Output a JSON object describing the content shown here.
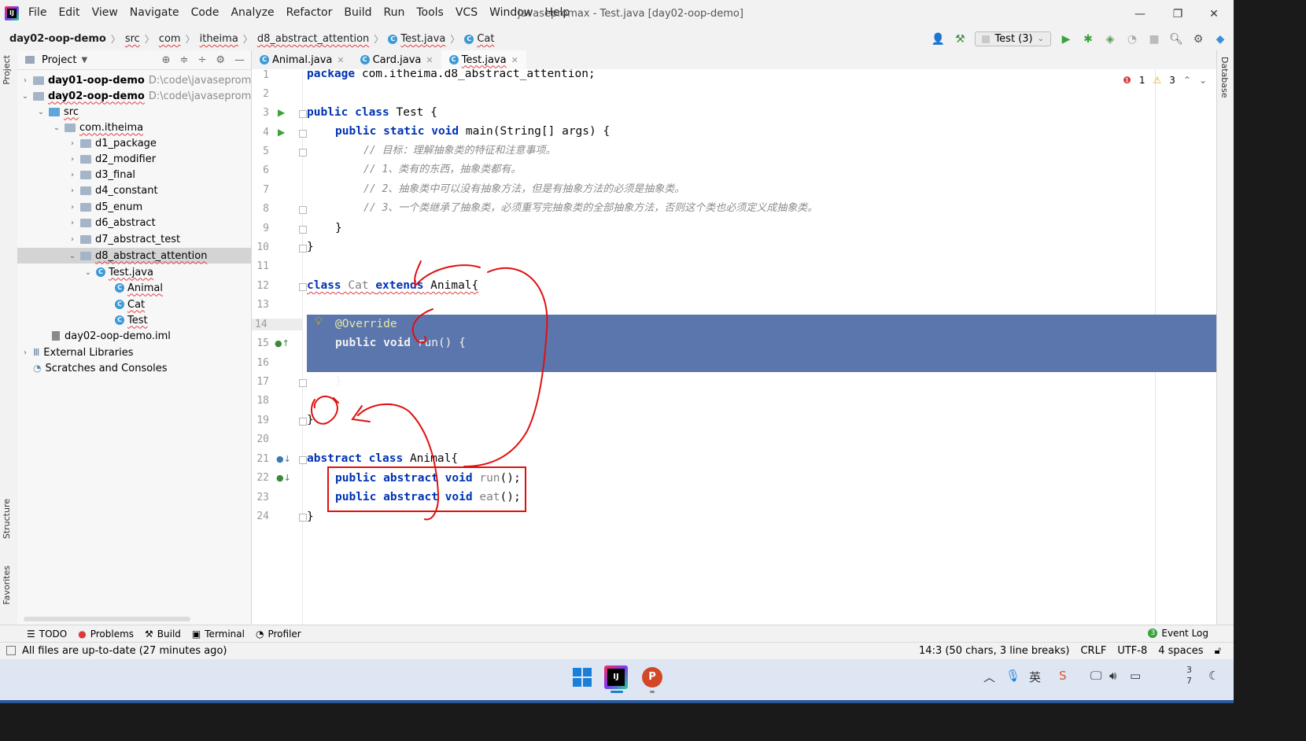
{
  "titlebar": {
    "menu": [
      "File",
      "Edit",
      "View",
      "Navigate",
      "Code",
      "Analyze",
      "Refactor",
      "Build",
      "Run",
      "Tools",
      "VCS",
      "Window",
      "Help"
    ],
    "window_title": "javasepromax - Test.java [day02-oop-demo]",
    "minimize": "—",
    "restore": "❐",
    "close": "✕"
  },
  "navbar": {
    "crumbs": [
      "day02-oop-demo",
      "src",
      "com",
      "itheima",
      "d8_abstract_attention",
      "Test.java",
      "Cat"
    ],
    "run_config": "Test (3)"
  },
  "left_tools": {
    "project_tab": "Project",
    "structure_tab": "Structure",
    "favorites_tab": "Favorites"
  },
  "right_tools": {
    "database_tab": "Database"
  },
  "project": {
    "title": "Project",
    "tree": [
      {
        "label": "day01-oop-demo",
        "path": "D:\\code\\javasepromax\\"
      },
      {
        "label": "day02-oop-demo",
        "path": "D:\\code\\javasepromax\\"
      },
      {
        "label": "src"
      },
      {
        "label": "com.itheima"
      },
      {
        "label": "d1_package"
      },
      {
        "label": "d2_modifier"
      },
      {
        "label": "d3_final"
      },
      {
        "label": "d4_constant"
      },
      {
        "label": "d5_enum"
      },
      {
        "label": "d6_abstract"
      },
      {
        "label": "d7_abstract_test"
      },
      {
        "label": "d8_abstract_attention"
      },
      {
        "label": "Test.java"
      },
      {
        "label": "Animal"
      },
      {
        "label": "Cat"
      },
      {
        "label": "Test"
      },
      {
        "label": "day02-oop-demo.iml"
      },
      {
        "label": "External Libraries"
      },
      {
        "label": "Scratches and Consoles"
      }
    ]
  },
  "tabs": [
    {
      "label": "Animal.java",
      "active": false
    },
    {
      "label": "Card.java",
      "active": false
    },
    {
      "label": "Test.java",
      "active": true
    }
  ],
  "editor": {
    "inspections": {
      "errors": "1",
      "warnings": "3"
    },
    "lines": {
      "l1_kw": "package",
      "l1_rest": " com.itheima.d8_abstract_attention;",
      "l3_kw": "public class",
      "l3_rest": " Test {",
      "l4_kw": "public static void",
      "l4_rest": " main(String[] args) {",
      "l5": "// 目标：理解抽象类的特征和注意事项。",
      "l6": "// 1、类有的东西，抽象类都有。",
      "l7": "// 2、抽象类中可以没有抽象方法，但是有抽象方法的必须是抽象类。",
      "l8": "// 3、一个类继承了抽象类，必须重写完抽象类的全部抽象方法，否则这个类也必须定义成抽象类。",
      "l9": "}",
      "l10": "}",
      "l12_kw1": "class",
      "l12_name": " Cat ",
      "l12_kw2": "extends",
      "l12_rest": " Animal{",
      "l14": "@Override",
      "l15_kw": "public void",
      "l15_rest": " run() {",
      "l17": "}",
      "l19": "}",
      "l21_kw": "abstract class",
      "l21_rest": " Animal{",
      "l22_kw": "public abstract void",
      "l22_m": " run",
      "l22_rest": "();",
      "l23_kw": "public abstract void",
      "l23_m": " eat",
      "l23_rest": "();",
      "l24": "}"
    },
    "line_numbers": [
      "1",
      "2",
      "3",
      "4",
      "5",
      "6",
      "7",
      "8",
      "9",
      "10",
      "11",
      "12",
      "13",
      "14",
      "15",
      "16",
      "17",
      "18",
      "19",
      "20",
      "21",
      "22",
      "23",
      "24"
    ]
  },
  "bottom_tools": [
    "TODO",
    "Problems",
    "Build",
    "Terminal",
    "Profiler"
  ],
  "event_log": "Event Log",
  "event_log_count": "3",
  "status": {
    "message": "All files are up-to-date (27 minutes ago)",
    "position": "14:3 (50 chars, 3 line breaks)",
    "line_sep": "CRLF",
    "encoding": "UTF-8",
    "indent": "4 spaces"
  },
  "taskbar": {
    "clock_top": "3",
    "clock_bottom": "7"
  },
  "colors": {
    "selection": "#5b76ad",
    "keyword": "#0033b3",
    "comment": "#8c8c8c",
    "annotation_red": "#e01010"
  }
}
